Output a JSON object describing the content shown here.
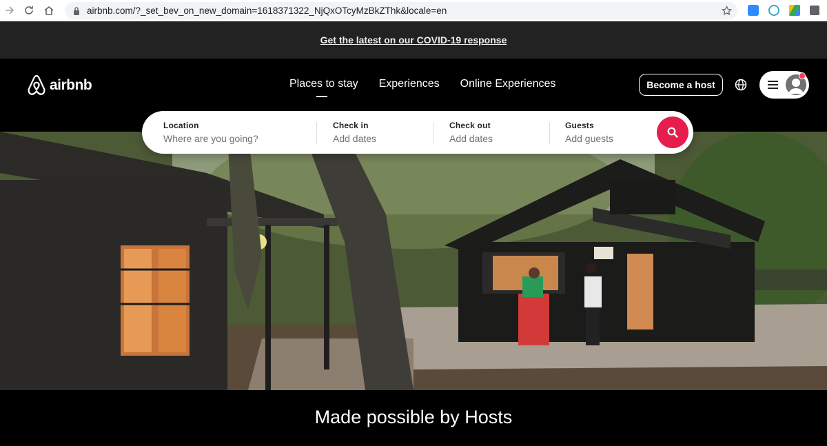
{
  "browser": {
    "url": "airbnb.com/?_set_bev_on_new_domain=1618371322_NjQxOTcyMzBkZThk&locale=en"
  },
  "banner": {
    "link_text": "Get the latest on our COVID-19 response"
  },
  "header": {
    "logo_text": "airbnb",
    "nav": [
      "Places to stay",
      "Experiences",
      "Online Experiences"
    ],
    "become_host": "Become a host"
  },
  "search": {
    "location": {
      "label": "Location",
      "placeholder": "Where are you going?"
    },
    "check_in": {
      "label": "Check in",
      "placeholder": "Add dates"
    },
    "check_out": {
      "label": "Check out",
      "placeholder": "Add dates"
    },
    "guests": {
      "label": "Guests",
      "placeholder": "Add guests"
    }
  },
  "hero": {
    "tagline": "Made possible by Hosts"
  },
  "colors": {
    "brand": "#ff385c",
    "search_button": "#e61e4d",
    "background": "#000000",
    "banner": "#222222"
  }
}
